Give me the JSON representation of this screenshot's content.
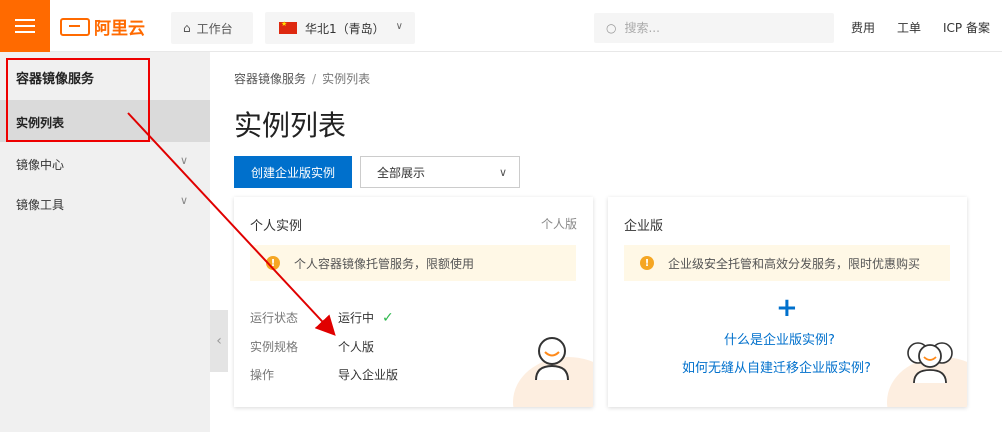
{
  "topbar": {
    "brand": "阿里云",
    "workbench_label": "工作台",
    "region_label": "华北1（青岛）",
    "search_placeholder": "搜索...",
    "links": [
      "费用",
      "工单",
      "ICP 备案"
    ]
  },
  "sidebar": {
    "title": "容器镜像服务",
    "active_item": "实例列表",
    "items": [
      {
        "label": "镜像中心"
      },
      {
        "label": "镜像工具"
      }
    ]
  },
  "main": {
    "breadcrumb": {
      "root": "容器镜像服务",
      "sep": "/",
      "current": "实例列表"
    },
    "title": "实例列表",
    "create_button": "创建企业版实例",
    "filter_value": "全部展示",
    "personal_card": {
      "title": "个人实例",
      "tag": "个人版",
      "notice": "个人容器镜像托管服务，限额使用",
      "rows": [
        {
          "key": "运行状态",
          "value": "运行中"
        },
        {
          "key": "实例规格",
          "value": "个人版"
        },
        {
          "key": "操作",
          "value": "导入企业版"
        }
      ]
    },
    "enterprise_card": {
      "title": "企业版",
      "notice": "企业级安全托管和高效分发服务，限时优惠购买",
      "link1": "什么是企业版实例?",
      "link2": "如何无缝从自建迁移企业版实例?"
    }
  },
  "colors": {
    "brand": "#ff6a00",
    "primary": "#0070cc",
    "annotation": "#e00000",
    "success": "#2db84d"
  }
}
